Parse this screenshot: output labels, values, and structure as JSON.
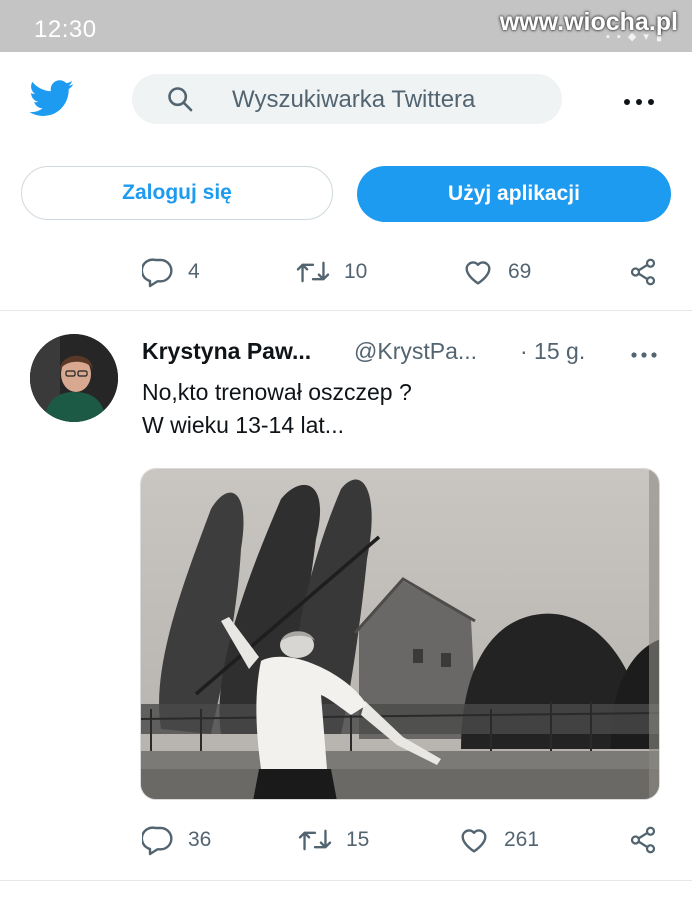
{
  "status_bar": {
    "time": "12:30",
    "watermark": "www.wiocha.pl"
  },
  "header": {
    "search_placeholder": "Wyszukiwarka Twittera",
    "logo_icon": "twitter-bird-icon",
    "more_icon": "more-horizontal-icon"
  },
  "auth": {
    "login_label": "Zaloguj się",
    "app_label": "Użyj aplikacji"
  },
  "prev_tweet_actions": {
    "replies": "4",
    "retweets": "10",
    "likes": "69"
  },
  "tweet": {
    "author_name": "Krystyna Paw...",
    "author_handle": "@KrystPa...",
    "time": "· 15 g.",
    "text_lines": [
      "No,kto trenował oszczep ?",
      "W wieku 13-14 lat..."
    ],
    "actions": {
      "replies": "36",
      "retweets": "15",
      "likes": "261"
    }
  },
  "colors": {
    "accent": "#1d9bf0",
    "muted": "#536471",
    "text": "#0f1419",
    "status_bar": "#c4c4c4"
  }
}
